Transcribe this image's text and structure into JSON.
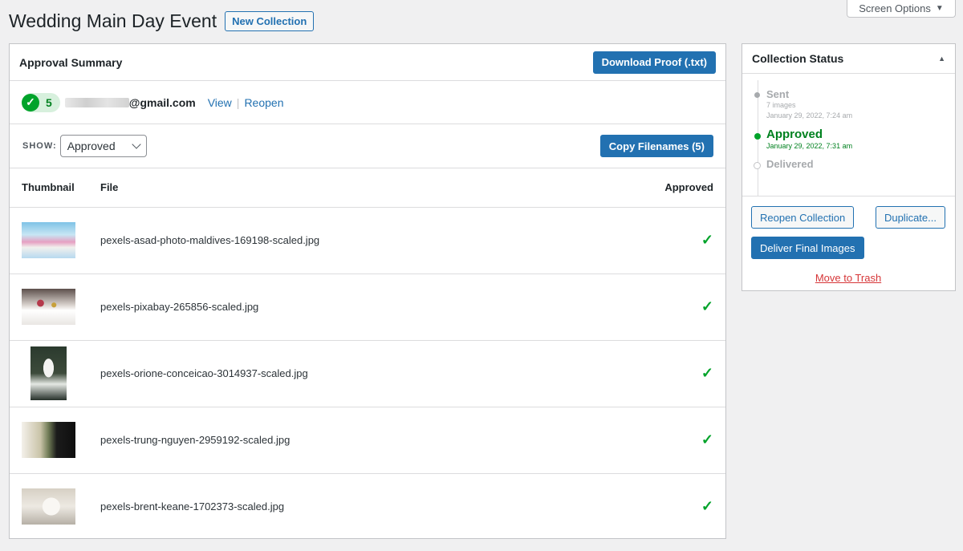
{
  "header": {
    "screen_options_label": "Screen Options",
    "page_title": "Wedding Main Day Event",
    "new_collection_label": "New Collection"
  },
  "summary": {
    "title": "Approval Summary",
    "download_label": "Download Proof (.txt)",
    "approved_count": "5",
    "email_suffix": "@gmail.com",
    "view_label": "View",
    "reopen_label": "Reopen",
    "show_label": "SHOW:",
    "filter_value": "Approved",
    "copy_filenames_label": "Copy Filenames (5)"
  },
  "table": {
    "columns": [
      "Thumbnail",
      "File",
      "Approved"
    ],
    "rows": [
      {
        "file": "pexels-asad-photo-maldives-169198-scaled.jpg",
        "approved": true
      },
      {
        "file": "pexels-pixabay-265856-scaled.jpg",
        "approved": true
      },
      {
        "file": "pexels-orione-conceicao-3014937-scaled.jpg",
        "approved": true
      },
      {
        "file": "pexels-trung-nguyen-2959192-scaled.jpg",
        "approved": true
      },
      {
        "file": "pexels-brent-keane-1702373-scaled.jpg",
        "approved": true
      }
    ]
  },
  "status": {
    "title": "Collection Status",
    "steps": [
      {
        "label": "Sent",
        "detail1": "7 images",
        "detail2": "January 29, 2022, 7:24 am"
      },
      {
        "label": "Approved",
        "detail1": "January 29, 2022, 7:31 am"
      },
      {
        "label": "Delivered"
      }
    ],
    "reopen_collection_label": "Reopen Collection",
    "duplicate_label": "Duplicate...",
    "deliver_label": "Deliver Final Images",
    "trash_label": "Move to Trash"
  },
  "colors": {
    "primary": "#2271b1",
    "success": "#00a32a",
    "danger": "#d63638"
  }
}
